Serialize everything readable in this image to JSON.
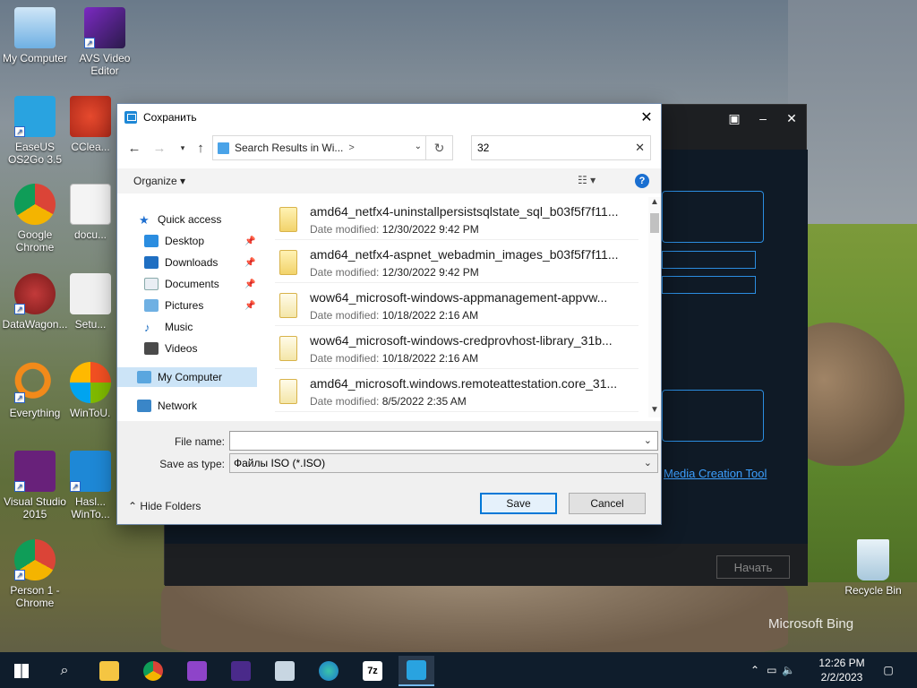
{
  "desktop": {
    "icons": [
      {
        "label": "My Computer"
      },
      {
        "label": "AVS Video Editor"
      },
      {
        "label": "EaseUS OS2Go 3.5"
      },
      {
        "label": "CClea..."
      },
      {
        "label": "Google Chrome"
      },
      {
        "label": "docu..."
      },
      {
        "label": "DataWagon..."
      },
      {
        "label": "Setu..."
      },
      {
        "label": "Everything"
      },
      {
        "label": "WinToU..."
      },
      {
        "label": "Visual Studio 2015"
      },
      {
        "label": "Hasl... WinTo..."
      },
      {
        "label": "Person 1 - Chrome"
      },
      {
        "label": "Recycle Bin"
      }
    ],
    "watermark": "Microsoft Bing"
  },
  "app_window": {
    "start_button": "Начать",
    "link": "Media Creation Tool"
  },
  "dialog": {
    "title": "Сохранить",
    "address": {
      "crumb": "Search Results in Wi...",
      "separator": ">"
    },
    "search": {
      "value": "32"
    },
    "toolbar": {
      "organize": "Organize ▾"
    },
    "nav": {
      "quick_access": "Quick access",
      "items": [
        {
          "label": "Desktop",
          "pinned": true
        },
        {
          "label": "Downloads",
          "pinned": true
        },
        {
          "label": "Documents",
          "pinned": true
        },
        {
          "label": "Pictures",
          "pinned": true
        },
        {
          "label": "Music",
          "pinned": false
        },
        {
          "label": "Videos",
          "pinned": false
        }
      ],
      "my_computer": "My Computer",
      "network": "Network"
    },
    "files": [
      {
        "name": "amd64_netfx4-uninstallpersistsqlstate_sql_b03f5f7f11...",
        "date_label": "Date modified:",
        "date": "12/30/2022 9:42 PM"
      },
      {
        "name": "amd64_netfx4-aspnet_webadmin_images_b03f5f7f11...",
        "date_label": "Date modified:",
        "date": "12/30/2022 9:42 PM"
      },
      {
        "name": "wow64_microsoft-windows-appmanagement-appvw...",
        "date_label": "Date modified:",
        "date": "10/18/2022 2:16 AM"
      },
      {
        "name": "wow64_microsoft-windows-credprovhost-library_31b...",
        "date_label": "Date modified:",
        "date": "10/18/2022 2:16 AM"
      },
      {
        "name": "amd64_microsoft.windows.remoteattestation.core_31...",
        "date_label": "Date modified:",
        "date": "8/5/2022 2:35 AM"
      }
    ],
    "file_name_label": "File name:",
    "file_name_value": "",
    "save_type_label": "Save as type:",
    "save_type_value": "Файлы ISO (*.ISO)",
    "hide_folders": "Hide Folders",
    "save_button": "Save",
    "cancel_button": "Cancel"
  },
  "taskbar": {
    "time": "12:26 PM",
    "date": "2/2/2023"
  }
}
